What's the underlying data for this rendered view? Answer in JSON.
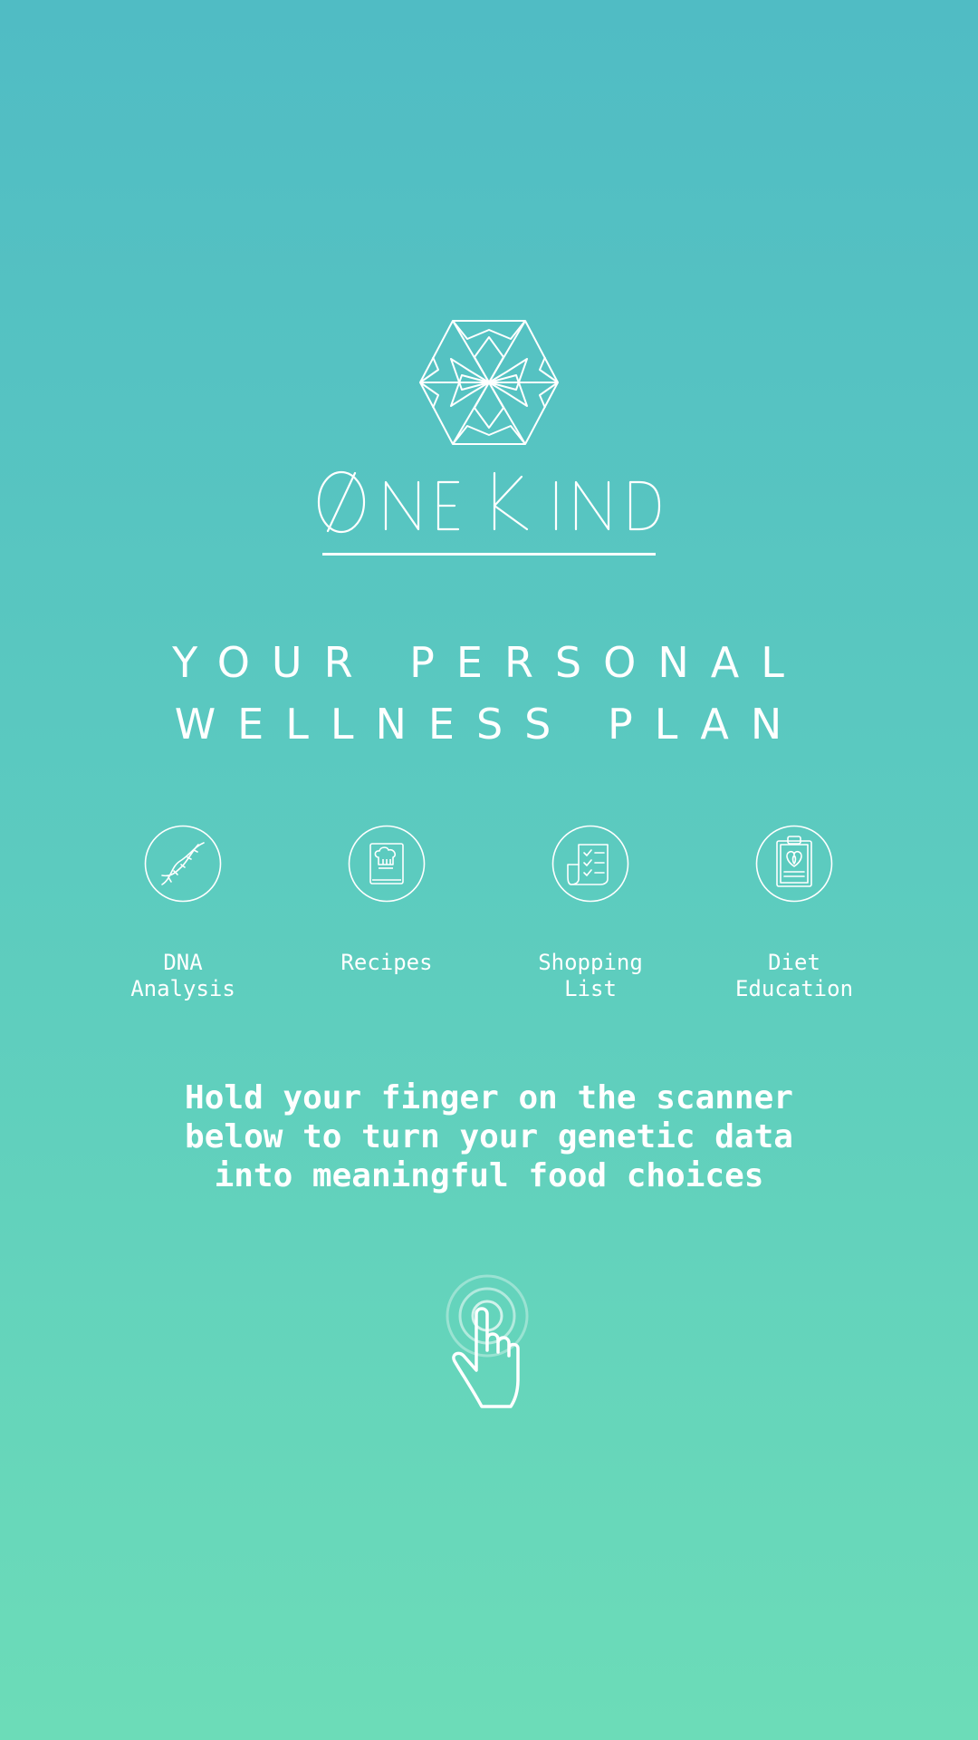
{
  "brand": {
    "name": "ØneKind",
    "logo_icon": "geometric-hexagon-logo"
  },
  "tagline": {
    "line1": "YOUR PERSONAL",
    "line2": "WELLNESS PLAN"
  },
  "features": [
    {
      "label": "DNA\nAnalysis",
      "icon": "dna-icon"
    },
    {
      "label": "Recipes",
      "icon": "recipe-book-icon"
    },
    {
      "label": "Shopping\nList",
      "icon": "checklist-icon"
    },
    {
      "label": "Diet\nEducation",
      "icon": "clipboard-heart-icon"
    }
  ],
  "instruction": "Hold your finger on the scanner\nbelow to turn your genetic data\ninto meaningful food choices",
  "scanner": {
    "icon": "finger-tap-icon"
  },
  "colors": {
    "gradient_top": "#50bcc4",
    "gradient_bottom": "#6cdcb8",
    "foreground": "#ffffff"
  }
}
